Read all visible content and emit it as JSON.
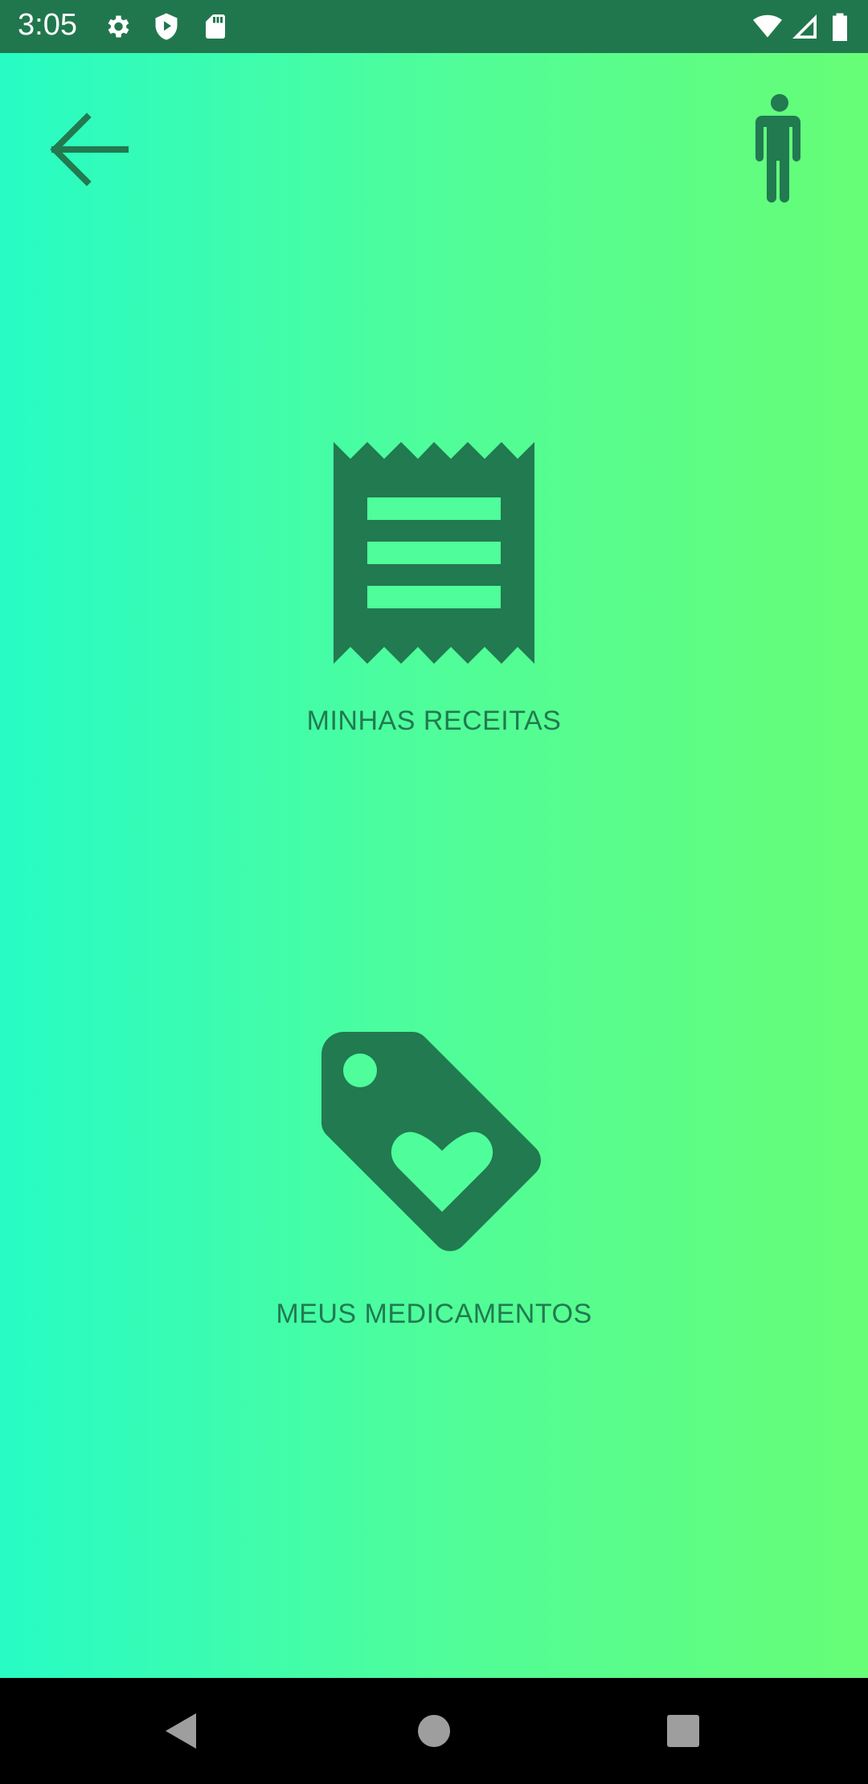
{
  "status_bar": {
    "time": "3:05",
    "left_icons": [
      "gear-icon",
      "shield-play-icon",
      "sd-card-icon"
    ],
    "right_icons": [
      "wifi-icon",
      "signal-icon",
      "battery-icon"
    ]
  },
  "toolbar": {
    "back_icon": "arrow-back-icon",
    "profile_icon": "person-icon"
  },
  "menu": {
    "items": [
      {
        "label": "MINHAS RECEITAS",
        "icon": "receipt-icon"
      },
      {
        "label": "MEUS MEDICAMENTOS",
        "icon": "tag-heart-icon"
      }
    ]
  },
  "nav_bar": {
    "buttons": [
      "back-triangle-icon",
      "home-circle-icon",
      "recents-square-icon"
    ]
  },
  "colors": {
    "accent": "#21774d",
    "gradient_start": "#27fcc5",
    "gradient_end": "#67fd76"
  }
}
